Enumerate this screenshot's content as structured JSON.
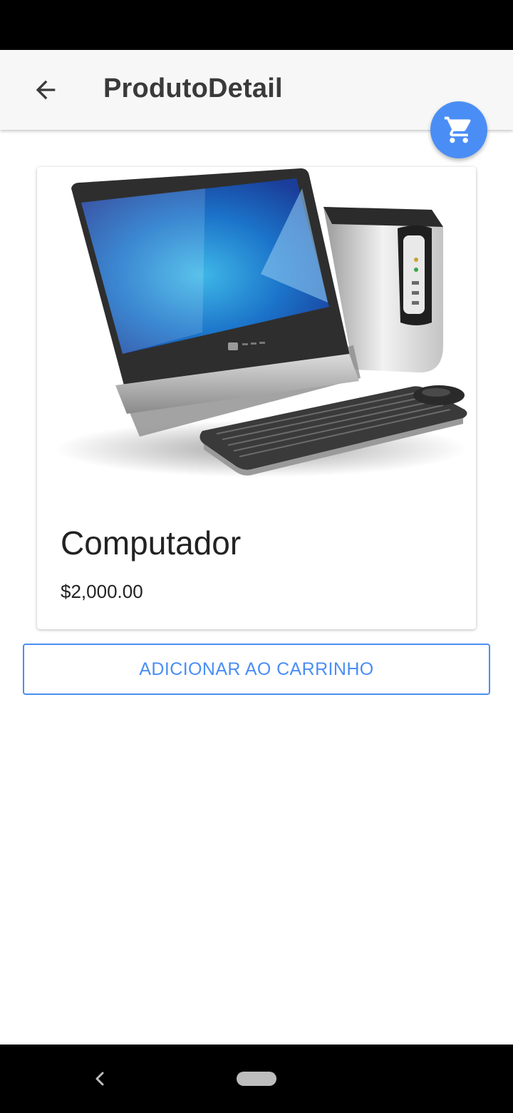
{
  "header": {
    "title": "ProdutoDetail",
    "back_icon": "arrow-left-icon"
  },
  "cart_fab": {
    "icon": "shopping-cart-icon",
    "color": "#4a8ef5"
  },
  "product": {
    "image": "desktop-computer-with-monitor-tower-keyboard-mouse",
    "name": "Computador",
    "price": "$2,000.00"
  },
  "actions": {
    "add_to_cart_label": "ADICIONAR AO CARRINHO"
  },
  "theme": {
    "accent": "#4a8ef5",
    "appbar_bg": "#f7f7f7"
  },
  "system_nav": {
    "back_icon": "chevron-left-icon",
    "home_icon": "home-pill-icon"
  }
}
